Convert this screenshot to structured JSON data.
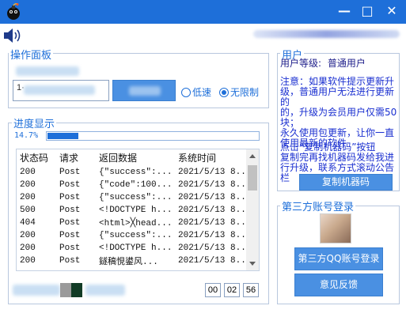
{
  "window": {
    "buttons": {
      "minimize": "—",
      "maximize": "□",
      "close": "✕"
    }
  },
  "toolbar": {
    "speaker_icon": "speaker-icon"
  },
  "operation_panel": {
    "title": "操作面板",
    "url_input_value": "1·",
    "radio_low": "低速",
    "radio_unlimited": "无限制",
    "selected_mode": "无限制"
  },
  "progress_panel": {
    "title": "进度显示",
    "progress_text": "14.7%",
    "progress_fraction": 0.147
  },
  "table": {
    "columns": [
      "状态码",
      "请求",
      "返回数据",
      "系统时间"
    ],
    "rows": [
      [
        "200",
        "Post",
        "{\"success\":...",
        "2021/5/13  8..."
      ],
      [
        "200",
        "Post",
        "{\"code\":100...",
        "2021/5/13  8..."
      ],
      [
        "200",
        "Post",
        "{\"success\":...",
        "2021/5/13  8..."
      ],
      [
        "500",
        "Post",
        "<!DOCTYPE h...",
        "2021/5/13  8..."
      ],
      [
        "404",
        "Post",
        "<html>╳head...",
        "2021/5/13  8..."
      ],
      [
        "200",
        "Post",
        "{\"success\":...",
        "2021/5/13  8..."
      ],
      [
        "200",
        "Post",
        "<!DOCTYPE h...",
        "2021/5/13  8..."
      ],
      [
        "200",
        "Post",
        "鐩稿悓鍙风...",
        "2021/5/13  8..."
      ]
    ]
  },
  "timer": {
    "hours": "00",
    "minutes": "02",
    "seconds": "56"
  },
  "user_panel": {
    "title": "用户",
    "level_label": "用户等级:",
    "level_value": "普通用户",
    "notice_lines": [
      "注意：如果软件提示更新升",
      "级，普通用户无法进行更新的",
      "的，升级为会员用户仅需50",
      "块；",
      "永久使用包更新，让你一直",
      "使用最新的软件"
    ],
    "copy_hint_lines": [
      "点击“复制机器码”按钮",
      "复制完再找机器码发给我进",
      "行升级，联系方式滚动公告",
      "栏"
    ],
    "copy_button": "复制机器码"
  },
  "third_party_panel": {
    "title": "第三方账号登录",
    "qq_login_button": "第三方QQ账号登录",
    "feedback_button": "意见反馈"
  },
  "colors": {
    "title_bar": "#1e6fd9",
    "accent": "#1e6fd9",
    "button": "#4a90e2",
    "notice_text": "#1a2fd0"
  }
}
